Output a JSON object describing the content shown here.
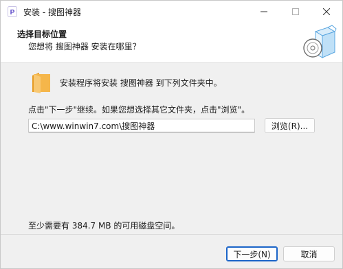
{
  "window": {
    "title": "安装 - 搜图神器",
    "app_icon_letter": "P"
  },
  "header": {
    "title": "选择目标位置",
    "subtitle": "您想将 搜图神器 安装在哪里？"
  },
  "body": {
    "intro": "安装程序将安装 搜图神器 到下列文件夹中。",
    "instruction": "点击\"下一步\"继续。如果您想选择其它文件夹，点击\"浏览\"。",
    "path_value": "C:\\www.winwin7.com\\搜图神器",
    "browse_label": "浏览(R)...",
    "space_required": "至少需要有 384.7 MB 的可用磁盘空间。"
  },
  "footer": {
    "next_label": "下一步(N)",
    "cancel_label": "取消"
  },
  "colors": {
    "accent": "#1a64c8",
    "folder": "#f5b64a",
    "box": "#5aa6e0"
  }
}
